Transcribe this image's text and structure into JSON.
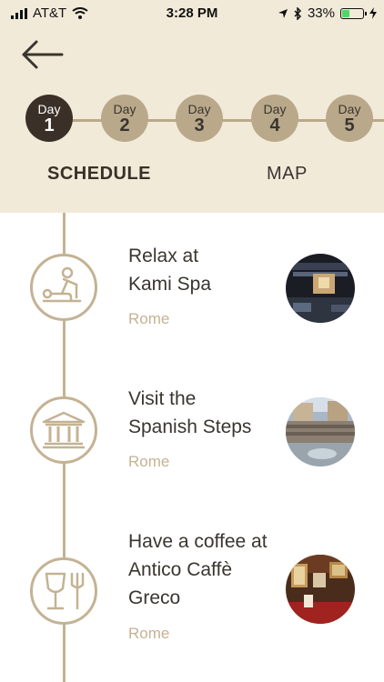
{
  "status_bar": {
    "carrier": "AT&T",
    "time": "3:28 PM",
    "battery": "33%"
  },
  "days": [
    {
      "word": "Day",
      "num": "1",
      "active": true
    },
    {
      "word": "Day",
      "num": "2",
      "active": false
    },
    {
      "word": "Day",
      "num": "3",
      "active": false
    },
    {
      "word": "Day",
      "num": "4",
      "active": false
    },
    {
      "word": "Day",
      "num": "5",
      "active": false
    }
  ],
  "tabs": {
    "schedule": "SCHEDULE",
    "map": "MAP"
  },
  "items": [
    {
      "line1": "Relax at",
      "line2": "Kami Spa",
      "line3": "",
      "location": "Rome",
      "icon": "massage-icon"
    },
    {
      "line1": "Visit the",
      "line2": "Spanish Steps",
      "line3": "",
      "location": "Rome",
      "icon": "monument-icon"
    },
    {
      "line1": "Have a coffee at",
      "line2": "Antico Caffè",
      "line3": "Greco",
      "location": "Rome",
      "icon": "dining-icon"
    }
  ],
  "colors": {
    "header_bg": "#f2ead9",
    "accent": "#c4b293",
    "active_day": "#3a3028"
  }
}
